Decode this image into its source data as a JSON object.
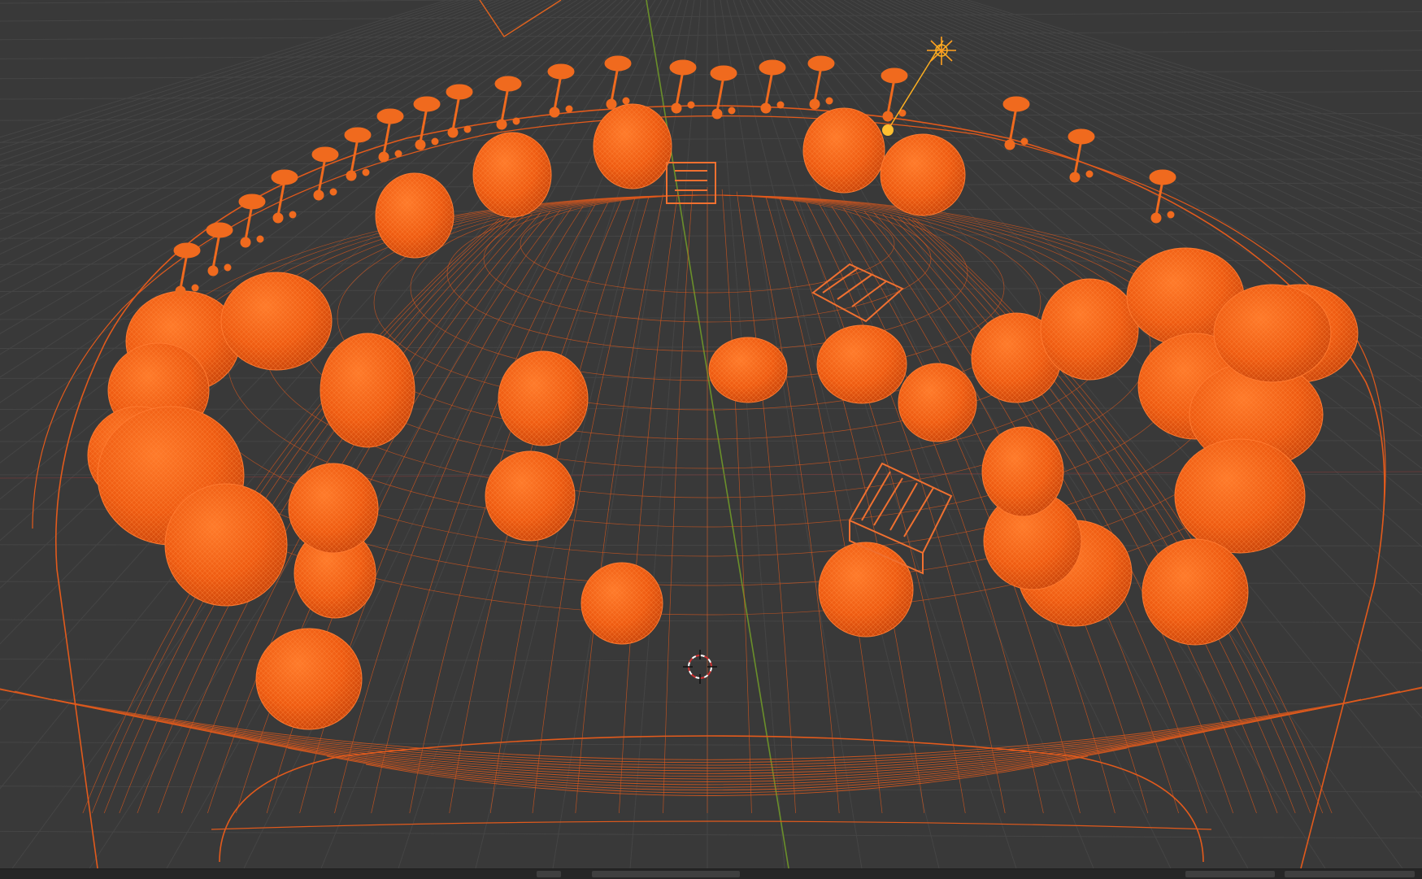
{
  "viewport": {
    "shading_mode": "wireframe",
    "selection_color": "#ff6a1a",
    "wire_color": "#e25a1c",
    "background_color": "#393939",
    "grid_color": "#444444",
    "axis_y_color": "#6a8f2a",
    "axis_x_color": "#8a3a3a",
    "light_color": "#ffb020"
  },
  "scene": {
    "objects": [
      {
        "name": "bowl-base",
        "type": "mesh"
      },
      {
        "name": "fruit-cluster",
        "type": "mesh"
      },
      {
        "name": "flower-ring",
        "type": "mesh"
      },
      {
        "name": "crates",
        "type": "mesh"
      },
      {
        "name": "light",
        "type": "light"
      },
      {
        "name": "camera",
        "type": "camera"
      },
      {
        "name": "3d-cursor",
        "type": "cursor"
      }
    ]
  },
  "statusbar": {
    "segments": 5
  }
}
